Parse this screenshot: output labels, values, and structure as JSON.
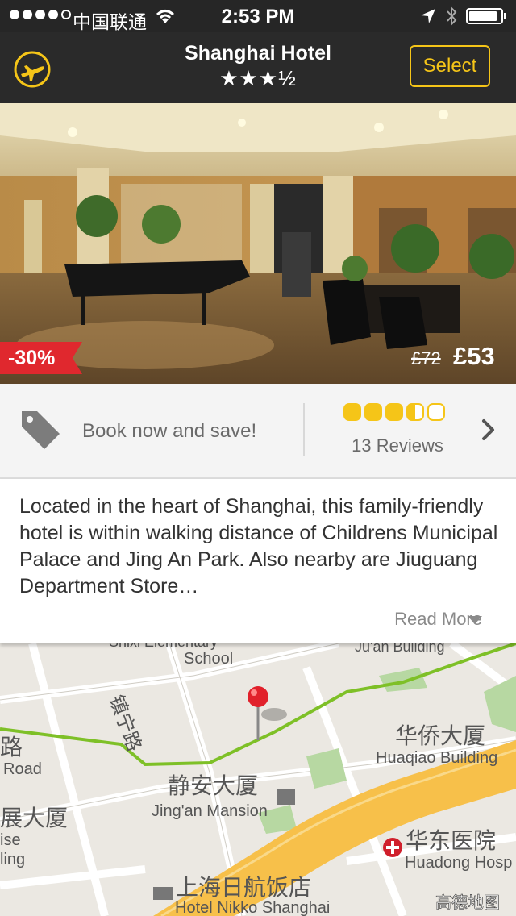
{
  "status_bar": {
    "carrier": "中国联通",
    "time": "2:53 PM"
  },
  "header": {
    "title": "Shanghai Hotel",
    "stars": "★★★½",
    "select_label": "Select"
  },
  "hero": {
    "discount": "-30%",
    "old_price": "£72",
    "new_price": "£53"
  },
  "info": {
    "book_text": "Book now and save!",
    "rating": 3.5,
    "reviews": "13 Reviews"
  },
  "description": {
    "text": "Located in the heart of Shanghai, this family-friendly hotel is within walking distance of Childrens Municipal Palace and Jing An Park. Also nearby are Jiuguang Department Store…",
    "read_more": "Read More"
  },
  "map": {
    "labels": {
      "school_top": "Shixi Elementary",
      "school": "School",
      "building_top": "Ju'an Building",
      "road_cn_vertical": "镇宁路",
      "road_cn_left": "路",
      "road_en_left": "Road",
      "huaqiao_cn": "华侨大厦",
      "huaqiao_en": "Huaqiao Building",
      "jingan_cn": "静安大厦",
      "jingan_en": "Jing'an Mansion",
      "zhan_cn": "展大厦",
      "ise": "ise",
      "ling": "ling",
      "huadong_cn": "华东医院",
      "huadong_en": "Huadong Hosp",
      "nikko_cn": "上海日航饭店",
      "nikko_en": "Hotel Nikko Shanghai",
      "attribution": "高德地图"
    }
  }
}
